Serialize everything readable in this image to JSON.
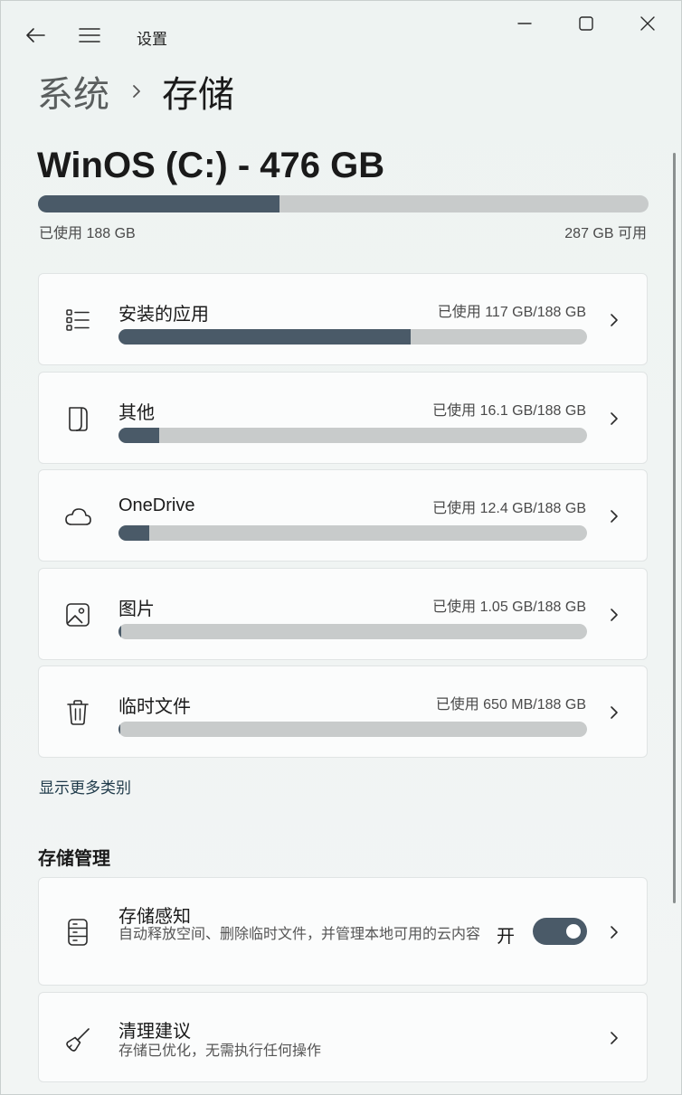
{
  "window": {
    "title": "设置",
    "icons": {
      "back": "back-arrow-icon",
      "menu": "hamburger-menu-icon",
      "minimize": "minimize-icon",
      "maximize": "maximize-icon",
      "close": "close-icon"
    }
  },
  "breadcrumb": {
    "parent": "系统",
    "current": "存储"
  },
  "drive": {
    "title": "WinOS (C:) - 476 GB",
    "used_label": "已使用 188 GB",
    "free_label": "287 GB 可用",
    "used_fraction": 0.395
  },
  "categories": [
    {
      "label": "安装的应用",
      "usage": "已使用 117 GB/188 GB",
      "fraction": 0.624,
      "icon": "list-icon"
    },
    {
      "label": "其他",
      "usage": "已使用 16.1 GB/188 GB",
      "fraction": 0.086,
      "icon": "document-icon"
    },
    {
      "label": "OneDrive",
      "usage": "已使用 12.4 GB/188 GB",
      "fraction": 0.066,
      "icon": "cloud-icon"
    },
    {
      "label": "图片",
      "usage": "已使用 1.05 GB/188 GB",
      "fraction": 0.006,
      "icon": "image-icon"
    },
    {
      "label": "临时文件",
      "usage": "已使用 650 MB/188 GB",
      "fraction": 0.0035,
      "icon": "trash-icon"
    }
  ],
  "show_more": "显示更多类别",
  "management": {
    "section_title": "存储管理",
    "storage_sense": {
      "label": "存储感知",
      "description": "自动释放空间、删除临时文件，并管理本地可用的云内容",
      "toggle_state": "开",
      "toggle_on": true,
      "icon": "server-storage-icon"
    },
    "cleanup": {
      "label": "清理建议",
      "description": "存储已优化，无需执行任何操作",
      "icon": "broom-icon"
    }
  },
  "colors": {
    "accent": "#4a5a68",
    "track": "#c8cbcb",
    "card": "#fbfcfc",
    "background": "#eef3f2"
  }
}
